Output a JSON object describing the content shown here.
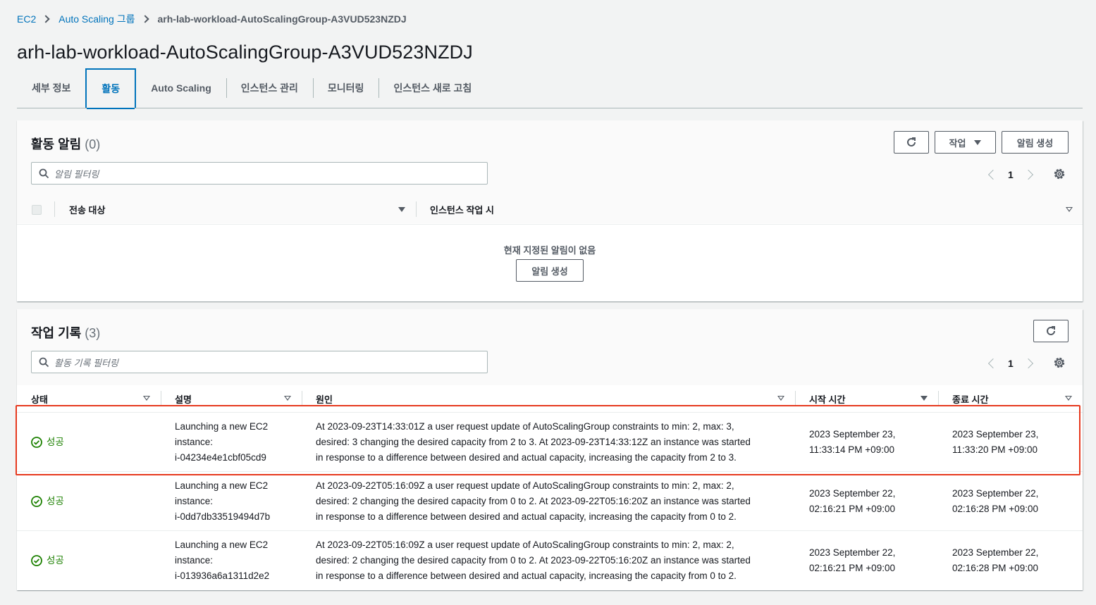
{
  "breadcrumb": {
    "items": [
      "EC2",
      "Auto Scaling 그룹"
    ],
    "current": "arh-lab-workload-AutoScalingGroup-A3VUD523NZDJ"
  },
  "title": "arh-lab-workload-AutoScalingGroup-A3VUD523NZDJ",
  "tabs": [
    {
      "label": "세부 정보"
    },
    {
      "label": "활동"
    },
    {
      "label": "Auto Scaling"
    },
    {
      "label": "인스턴스 관리"
    },
    {
      "label": "모니터링"
    },
    {
      "label": "인스턴스 새로 고침"
    }
  ],
  "notifications": {
    "title": "활동 알림",
    "count": "(0)",
    "refresh_icon": "refresh-icon",
    "actions_label": "작업",
    "create_label": "알림 생성",
    "filter_placeholder": "알림 필터링",
    "page": "1",
    "columns": [
      "전송 대상",
      "인스턴스 작업 시"
    ],
    "empty_text": "현재 지정된 알림이 없음",
    "empty_button": "알림 생성"
  },
  "history": {
    "title": "작업 기록",
    "count": "(3)",
    "filter_placeholder": "활동 기록 필터링",
    "page": "1",
    "columns": [
      "상태",
      "설명",
      "원인",
      "시작 시간",
      "종료 시간"
    ],
    "rows": [
      {
        "status": "성공",
        "desc": [
          "Launching a new EC2",
          "instance:",
          "i-04234e4e1cbf05cd9"
        ],
        "cause": [
          "At 2023-09-23T14:33:01Z a user request update of AutoScalingGroup constraints to min: 2, max: 3,",
          "desired: 3 changing the desired capacity from 2 to 3. At 2023-09-23T14:33:12Z an instance was started",
          "in response to a difference between desired and actual capacity, increasing the capacity from 2 to 3."
        ],
        "start": [
          "2023 September 23,",
          "11:33:14 PM +09:00"
        ],
        "end": [
          "2023 September 23,",
          "11:33:20 PM +09:00"
        ]
      },
      {
        "status": "성공",
        "desc": [
          "Launching a new EC2",
          "instance:",
          "i-0dd7db33519494d7b"
        ],
        "cause": [
          "At 2023-09-22T05:16:09Z a user request update of AutoScalingGroup constraints to min: 2, max: 2,",
          "desired: 2 changing the desired capacity from 0 to 2. At 2023-09-22T05:16:20Z an instance was started",
          "in response to a difference between desired and actual capacity, increasing the capacity from 0 to 2."
        ],
        "start": [
          "2023 September 22,",
          "02:16:21 PM +09:00"
        ],
        "end": [
          "2023 September 22,",
          "02:16:28 PM +09:00"
        ]
      },
      {
        "status": "성공",
        "desc": [
          "Launching a new EC2",
          "instance:",
          "i-013936a6a1311d2e2"
        ],
        "cause": [
          "At 2023-09-22T05:16:09Z a user request update of AutoScalingGroup constraints to min: 2, max: 2,",
          "desired: 2 changing the desired capacity from 0 to 2. At 2023-09-22T05:16:20Z an instance was started",
          "in response to a difference between desired and actual capacity, increasing the capacity from 0 to 2."
        ],
        "start": [
          "2023 September 22,",
          "02:16:21 PM +09:00"
        ],
        "end": [
          "2023 September 22,",
          "02:16:28 PM +09:00"
        ]
      }
    ]
  },
  "colors": {
    "link": "#0073bb",
    "success": "#1d8102",
    "highlight": "#e6391e"
  }
}
